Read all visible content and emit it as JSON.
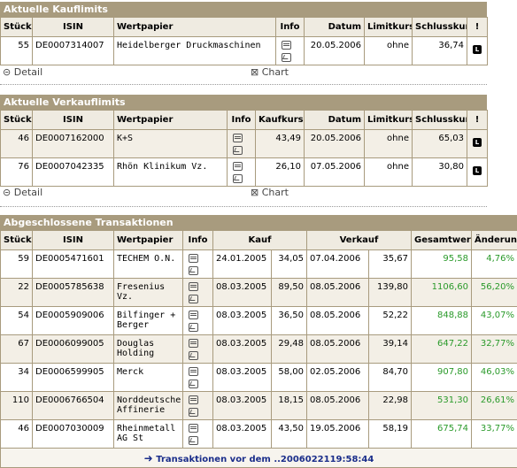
{
  "kauflimits": {
    "title": "Aktuelle Kauflimits",
    "headers": [
      "Stück",
      "ISIN",
      "Wertpapier",
      "Info",
      "Datum",
      "Limitkurs",
      "Schlusskurs",
      "!"
    ],
    "rows": [
      {
        "stueck": "55",
        "isin": "DE0007314007",
        "name": "Heidelberger Druckmaschinen",
        "datum": "20.05.2006",
        "limit": "ohne",
        "schluss": "36,74"
      }
    ]
  },
  "links1": {
    "detail": "Detail",
    "chart": "Chart"
  },
  "verkauflimits": {
    "title": "Aktuelle Verkauflimits",
    "headers": [
      "Stück",
      "ISIN",
      "Wertpapier",
      "Info",
      "Kaufkurs",
      "Datum",
      "Limitkurs",
      "Schlusskurs",
      "!"
    ],
    "rows": [
      {
        "stueck": "46",
        "isin": "DE0007162000",
        "name": "K+S",
        "kaufkurs": "43,49",
        "datum": "20.05.2006",
        "limit": "ohne",
        "schluss": "65,03"
      },
      {
        "stueck": "76",
        "isin": "DE0007042335",
        "name": "Rhön Klinikum Vz.",
        "kaufkurs": "26,10",
        "datum": "07.05.2006",
        "limit": "ohne",
        "schluss": "30,80"
      }
    ]
  },
  "links2": {
    "detail": "Detail",
    "chart": "Chart"
  },
  "transaktionen": {
    "title": "Abgeschlossene Transaktionen",
    "headers": [
      "Stück",
      "ISIN",
      "Wertpapier",
      "Info",
      "Kauf",
      "Verkauf",
      "Gesamtwert",
      "Änderung"
    ],
    "rows": [
      {
        "stueck": "59",
        "isin": "DE0005471601",
        "name": "TECHEM O.N.",
        "kdatum": "24.01.2005",
        "kkurs": "34,05",
        "vdatum": "07.04.2006",
        "vkurs": "35,67",
        "gesamt": "95,58",
        "aend": "4,76%"
      },
      {
        "stueck": "22",
        "isin": "DE0005785638",
        "name": "Fresenius Vz.",
        "kdatum": "08.03.2005",
        "kkurs": "89,50",
        "vdatum": "08.05.2006",
        "vkurs": "139,80",
        "gesamt": "1106,60",
        "aend": "56,20%"
      },
      {
        "stueck": "54",
        "isin": "DE0005909006",
        "name": "Bilfinger + Berger",
        "kdatum": "08.03.2005",
        "kkurs": "36,50",
        "vdatum": "08.05.2006",
        "vkurs": "52,22",
        "gesamt": "848,88",
        "aend": "43,07%"
      },
      {
        "stueck": "67",
        "isin": "DE0006099005",
        "name": "Douglas Holding",
        "kdatum": "08.03.2005",
        "kkurs": "29,48",
        "vdatum": "08.05.2006",
        "vkurs": "39,14",
        "gesamt": "647,22",
        "aend": "32,77%"
      },
      {
        "stueck": "34",
        "isin": "DE0006599905",
        "name": "Merck",
        "kdatum": "08.03.2005",
        "kkurs": "58,00",
        "vdatum": "02.05.2006",
        "vkurs": "84,70",
        "gesamt": "907,80",
        "aend": "46,03%"
      },
      {
        "stueck": "110",
        "isin": "DE0006766504",
        "name": "Norddeutsche Affinerie",
        "kdatum": "08.03.2005",
        "kkurs": "18,15",
        "vdatum": "08.05.2006",
        "vkurs": "22,98",
        "gesamt": "531,30",
        "aend": "26,61%"
      },
      {
        "stueck": "46",
        "isin": "DE0007030009",
        "name": "Rheinmetall AG St",
        "kdatum": "08.03.2005",
        "kkurs": "43,50",
        "vdatum": "19.05.2006",
        "vkurs": "58,19",
        "gesamt": "675,74",
        "aend": "33,77%"
      }
    ],
    "older_link": "Transaktionen vor dem ..2006022119:58:44"
  },
  "colors": {
    "header_bg": "#a89b7e",
    "row_alt": "#f3efe6",
    "positive": "#2a9a2a",
    "link": "#1a2d8a"
  }
}
